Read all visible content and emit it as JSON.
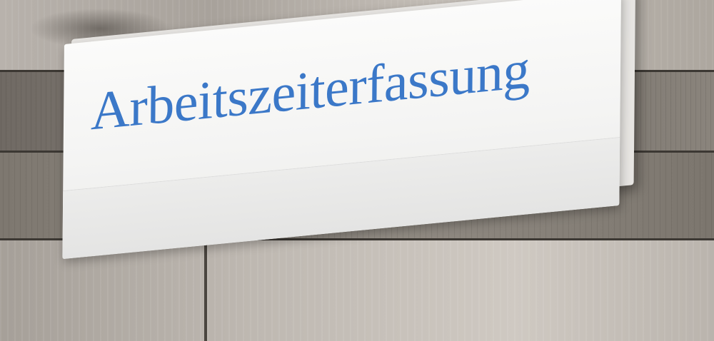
{
  "photo": {
    "subject": "newspaper",
    "headline": "Arbeitszeiterfassung",
    "colors": {
      "headline": "#3b78c8",
      "paper": "#f6f6f5",
      "wood_light": "#beb8b1",
      "wood_dark": "#6f6963"
    }
  }
}
